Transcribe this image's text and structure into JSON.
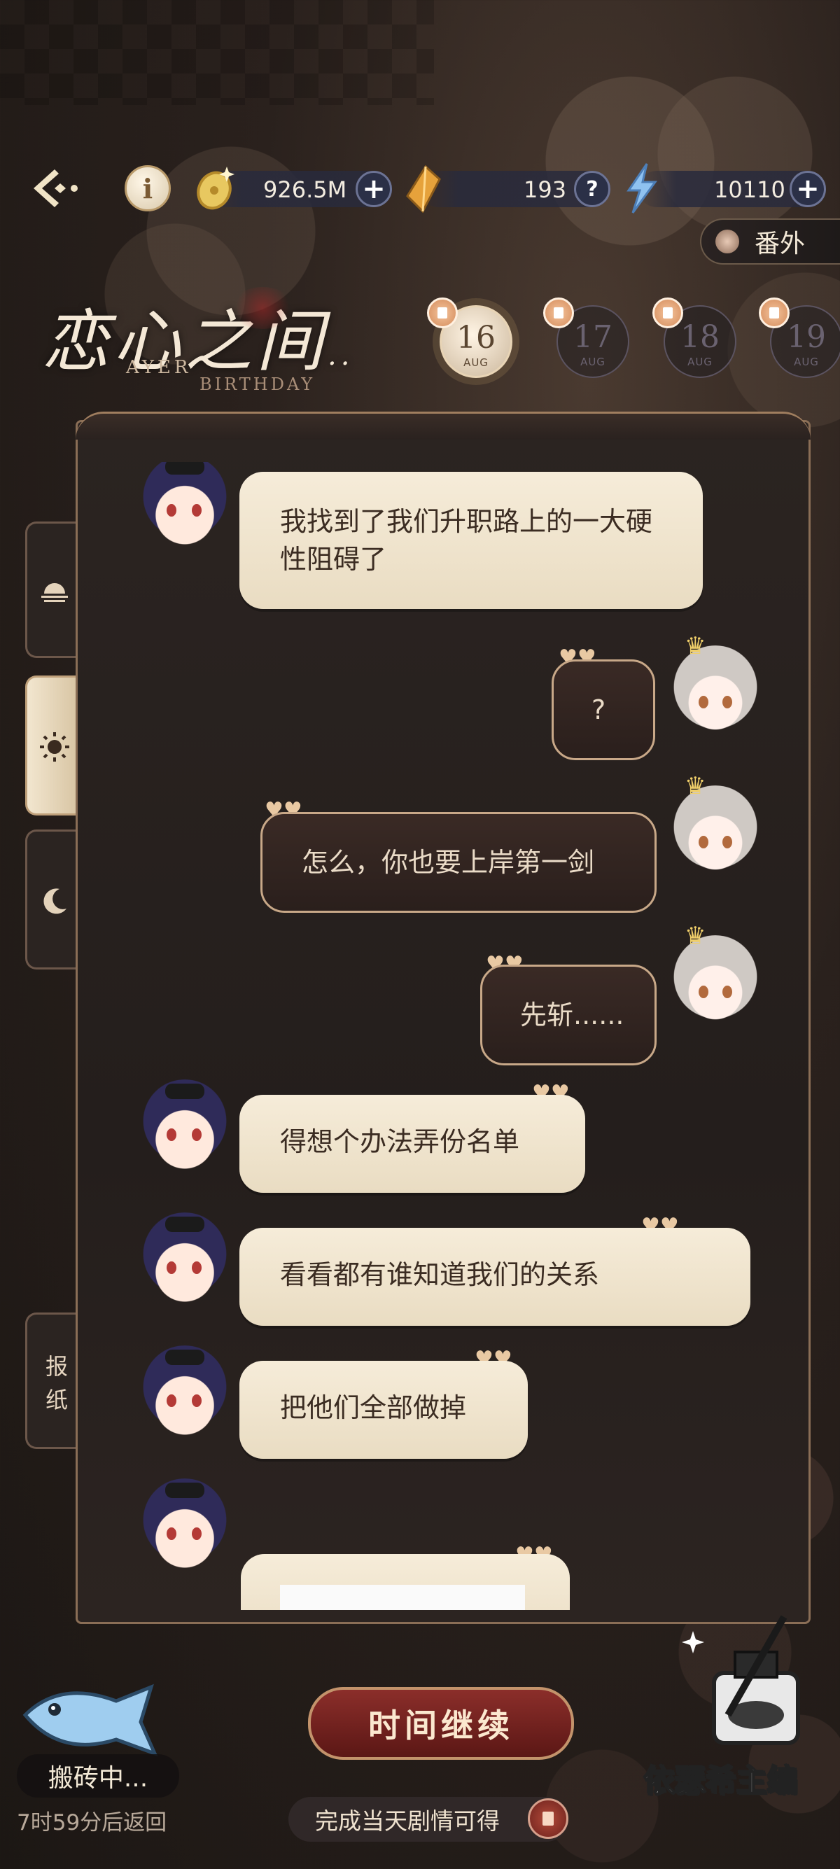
{
  "header": {
    "info_label": "i",
    "gold": {
      "value": "926.5M",
      "plus": "+"
    },
    "gems": {
      "value": "193",
      "help": "?"
    },
    "energy": {
      "value": "10110",
      "plus": "+"
    },
    "extra_label": "番外"
  },
  "logo": {
    "title": "恋心之间",
    "ellipsis": "..",
    "sub1": "AYER",
    "sub2": "BIRTHDAY"
  },
  "dates": [
    {
      "day": "16",
      "month": "AUG",
      "active": true
    },
    {
      "day": "17",
      "month": "AUG",
      "active": false
    },
    {
      "day": "18",
      "month": "AUG",
      "active": false
    },
    {
      "day": "19",
      "month": "AUG",
      "active": false
    }
  ],
  "side_tabs": {
    "news_label": "报纸"
  },
  "messages": [
    {
      "sender": "boy",
      "text": "我找到了我们升职路上的一大硬性阻碍了"
    },
    {
      "sender": "girl",
      "text": "?"
    },
    {
      "sender": "girl",
      "text": "怎么，你也要上岸第一剑"
    },
    {
      "sender": "girl",
      "text": "先斩......"
    },
    {
      "sender": "boy",
      "text": "得想个办法弄份名单"
    },
    {
      "sender": "boy",
      "text": "看看都有谁知道我们的关系"
    },
    {
      "sender": "boy",
      "text": "把他们全部做掉"
    },
    {
      "sender": "boy",
      "text": ""
    }
  ],
  "bottom": {
    "continue_label": "时间继续",
    "reward_text": "完成当天剧情可得",
    "status_label": "搬砖中...",
    "return_text": "7时59分后返回",
    "watermark": "依瑟希主编"
  },
  "colors": {
    "accent": "#c3936b",
    "bubble_light": "#f6ecd9",
    "bubble_dark": "#2a1f1c",
    "button_red": "#8b2e2a"
  },
  "icons": [
    "back-arrow-icon",
    "info-icon",
    "coin-icon",
    "gem-icon",
    "bolt-icon",
    "plus-icon",
    "question-icon",
    "sunrise-icon",
    "sun-icon",
    "moon-icon",
    "gift-icon",
    "fish-icon",
    "ink-bottle-icon"
  ]
}
